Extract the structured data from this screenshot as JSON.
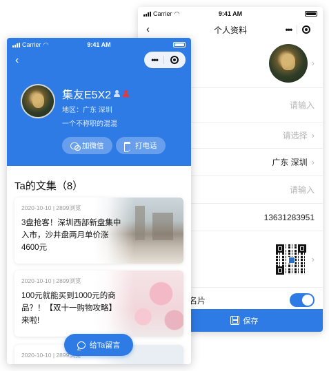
{
  "back_screen": {
    "status_bar": {
      "carrier": "Carrier",
      "time": "9:41 AM"
    },
    "nav": {
      "title": "个人资料",
      "menu_icon": "more-dots-icon",
      "close_icon": "target-circle-icon"
    },
    "rows": [
      {
        "id": "avatar",
        "chevron": "›"
      },
      {
        "id": "name",
        "placeholder": "请输入"
      },
      {
        "id": "select",
        "placeholder": "请选择",
        "chevron": "›"
      },
      {
        "id": "region",
        "value": "广东 深圳",
        "chevron": "›"
      },
      {
        "id": "input2",
        "placeholder": "请输入"
      },
      {
        "id": "phone",
        "value": "13631283951"
      },
      {
        "id": "qrcode",
        "chevron": "›"
      },
      {
        "id": "card",
        "label_partial": "名片",
        "toggle_on": true
      }
    ],
    "save_label": "保存"
  },
  "front_screen": {
    "status_bar": {
      "carrier": "Carrier",
      "time": "9:41 AM"
    },
    "profile": {
      "name": "集友E5X2",
      "region": "地区：广东 深圳",
      "motto": "一个不称职的混混"
    },
    "actions": {
      "wechat": "加微信",
      "call": "打电话"
    },
    "section_title": "Ta的文集（8）",
    "articles": [
      {
        "meta": "2020-10-10 | 2899浏览",
        "title": "3盘抢客！深圳西部新盘集中入市，沙井盘两月单价涨4600元"
      },
      {
        "meta": "2020-10-10 | 2899浏览",
        "title": "100元就能买到1000元的商品？！【双十一购物攻略】来啦!"
      },
      {
        "meta": "2020-10-10 | 2899浏览",
        "title": ""
      }
    ],
    "message_button": "给Ta留言"
  },
  "colors": {
    "primary": "#2e7be6",
    "placeholder": "#b5b5b5",
    "divider": "#eeeeee"
  }
}
